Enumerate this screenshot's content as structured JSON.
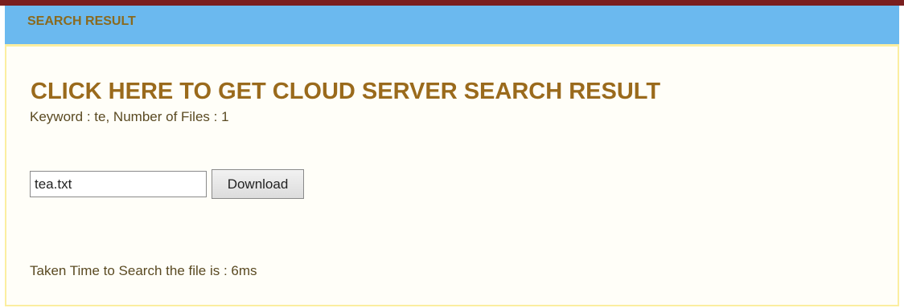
{
  "panel": {
    "header_title": "SEARCH RESULT"
  },
  "result": {
    "link_text": "CLICK HERE TO GET CLOUD SERVER SEARCH RESULT",
    "summary": "Keyword : te, Number of Files : 1",
    "file_name": "tea.txt",
    "download_label": "Download",
    "timing": "Taken Time to Search the file is : 6ms"
  },
  "colors": {
    "header_bg": "#6bb9ef",
    "title_text": "#9a6a1c",
    "panel_border": "#fbeea0",
    "top_strip": "#7a1f1f"
  }
}
